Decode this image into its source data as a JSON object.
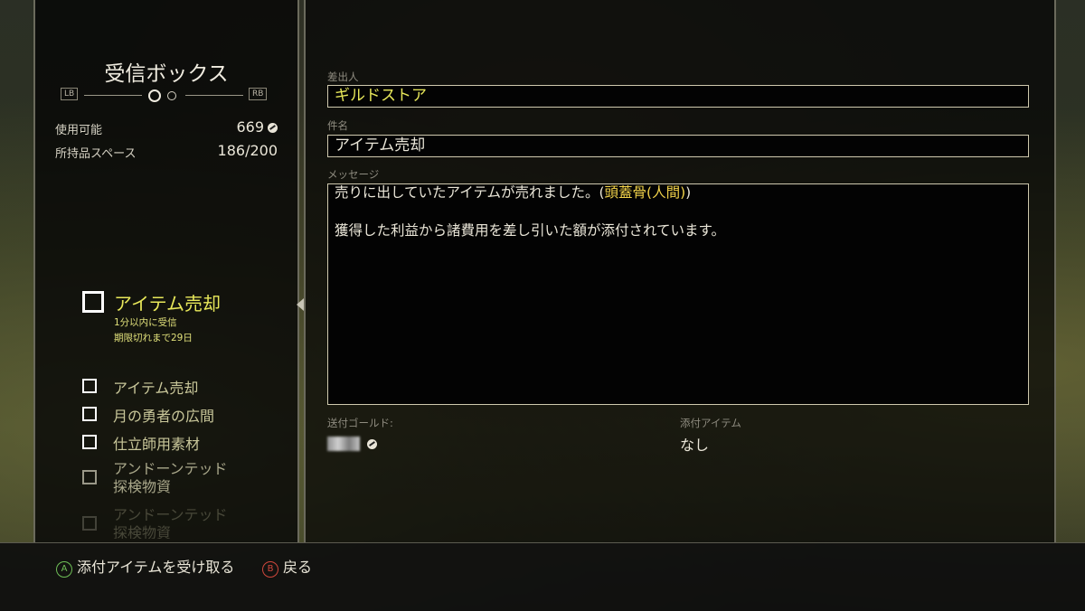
{
  "sidebar": {
    "title": "受信ボックス",
    "pager": {
      "left_key": "LB",
      "right_key": "RB"
    },
    "stats": [
      {
        "label": "使用可能",
        "value": "669"
      },
      {
        "label": "所持品スペース",
        "value": "186/200"
      }
    ],
    "selected": {
      "title": "アイテム売却",
      "received": "1分以内に受信",
      "expires": "期限切れまで29日"
    },
    "items": [
      {
        "label": "アイテム売却"
      },
      {
        "label": "月の勇者の広間"
      },
      {
        "label": "仕立師用素材"
      },
      {
        "label": "アンドーンテッド\n探検物資"
      },
      {
        "label": "アンドーンテッド\n探検物資"
      }
    ]
  },
  "message": {
    "sender_label": "差出人",
    "sender": "ギルドストア",
    "subject_label": "件名",
    "subject": "アイテム売却",
    "body_label": "メッセージ",
    "body_line1_prefix": "売りに出していたアイテムが売れました。(",
    "body_line1_item": "頭蓋骨(人間)",
    "body_line1_suffix": ")",
    "body_line2": "獲得した利益から諸費用を差し引いた額が添付されています。",
    "gold_label": "送付ゴールド:",
    "attach_label": "添付アイテム",
    "attach_value": "なし"
  },
  "footer": {
    "take_key": "A",
    "take_label": "添付アイテムを受け取る",
    "back_key": "B",
    "back_label": "戻る"
  },
  "colors": {
    "accent_yellow": "#e8e85a",
    "item_gold": "#f2d34a",
    "a_button": "#6fbf57",
    "b_button": "#d0473c"
  }
}
